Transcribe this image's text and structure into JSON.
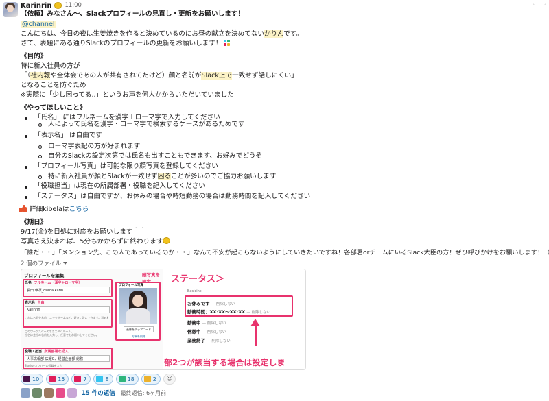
{
  "message": {
    "author": "Karinrin",
    "author_emoji": "lemon-emoji",
    "timestamp": "11:00",
    "title": "【依頼】みなさん〜、Slackプロフィールの見直し・更新をお願いします！",
    "mention": "@channel",
    "intro_1a": "こんにちは、今日の夜は生姜焼きを作ると決めているのにお昼の献立を決めてない",
    "intro_1b": "かりん",
    "intro_1c": "です。",
    "intro_2": "さて、表題にある通りSlackのプロフィールの更新をお願いします！",
    "purpose_heading": "《目的》",
    "purpose_1": "特に新入社員の方が",
    "purpose_2a": "「（",
    "purpose_2b": "社内報",
    "purpose_2c": "や全体会であの人が共有されてたけど）顔と名前が",
    "purpose_2d": "Slack上で",
    "purpose_2e": "一致せず話しにくい」",
    "purpose_3": "となることを防ぐため",
    "purpose_4": "※実際に「少し困ってる..」というお声を何人かからいただいていました",
    "todo_heading": "《やってほしいこと》",
    "todo_items": [
      "「氏名」 にはフルネームを漢字＋ローマ字で入力してください",
      "人によって氏名を漢字・ローマ字で検索するケースがあるためです",
      "「表示名」 は自由です",
      "ローマ字表記の方が好まれます",
      "自分のSlackの設定次第では氏名も出すこともできます、お好みでどうぞ",
      "「プロフィール写真」は可能な限り顔写真を登録してください",
      "特に新入社員が顔とSlackが一致せず",
      "困る",
      "ことが多いのでご協力お願いします",
      "「役職担当」は現在の所属部署・役職を記入してください",
      "「ステータス」は自由ですが、お休みの場合や時短勤務の場合は勤務時間を記入してください"
    ],
    "detail_prefix": "詳細kibelaは",
    "detail_link": "こちら",
    "deadline_heading": "《期日》",
    "deadline_1": "9/17(金)を目処に対応をお願いします＾＾",
    "deadline_2": "写真さえ決まれば、5分もかからずに終わります",
    "closing": "「誰だ・・」「メンション先、この人であっているのか・・」なんて不安が起こらないようにしていきたいですね！各部署orチームにいるSlack大臣の方！ぜひ呼びかけをお願いします！（ｲﾙｶﾅ...）"
  },
  "files": {
    "label": "2 個のファイル",
    "image": {
      "form_title": "プロフィールを編集",
      "name_label": "氏名",
      "name_annotation": "フルネーム（漢字＋ローマ字）",
      "name_value": "長田 華凛_osada karin",
      "display_label": "表示名",
      "display_annotation": "自由",
      "display_value": "Karinrin",
      "display_help": "これは名前や名前、ニックネームなど。好きに設定できます。Slack でメンバーが呼ぶのに使う名前です。",
      "custom_help": "このワークスペースのカスタムルール。\n社名は会社の名前を入力し、任意でもお願いしてください。",
      "role_label": "役職・担当",
      "role_annotation": "所属部署を記入",
      "role_value": "人事広報部 広報G、経営企画部 総務",
      "role_help": "Slackのメンバーの役職を入力",
      "photo_label": "プロフィール写真",
      "photo_upload": "画像をアップロード",
      "photo_delete": "写真を削除",
      "photo_annotation": "顔写真を設定",
      "status_title": "ステータス＞",
      "status_company": "Basicinc",
      "status_rows": [
        {
          "label": "お休みです",
          "sub": "— 削除しない"
        },
        {
          "label": "勤務時間：XX:XX〜XX:XX",
          "sub": "— 削除しない"
        },
        {
          "label": "勤務中",
          "sub": "— 削除しない"
        },
        {
          "label": "休憩中",
          "sub": "— 削除しない"
        },
        {
          "label": "業務終了",
          "sub": "— 削除しない"
        }
      ],
      "status_note": "部2つが該当する場合は設定しま"
    }
  },
  "reactions": [
    {
      "icon": "slack-icon",
      "count": "10",
      "color": "#4a154b"
    },
    {
      "icon": "red-icon",
      "count": "15",
      "color": "#e01e5a"
    },
    {
      "icon": "grid-icon",
      "count": "7",
      "color": "#e01e5a"
    },
    {
      "icon": "hand-icon",
      "count": "8",
      "color": "#36c5f0"
    },
    {
      "icon": "done-icon",
      "count": "18",
      "color": "#2eb67d"
    },
    {
      "icon": "thanks-icon",
      "count": "2",
      "color": "#ecb22e"
    }
  ],
  "thread": {
    "replies": "15 件の返信",
    "last_reply": "最終返信: 6ヶ月前"
  }
}
